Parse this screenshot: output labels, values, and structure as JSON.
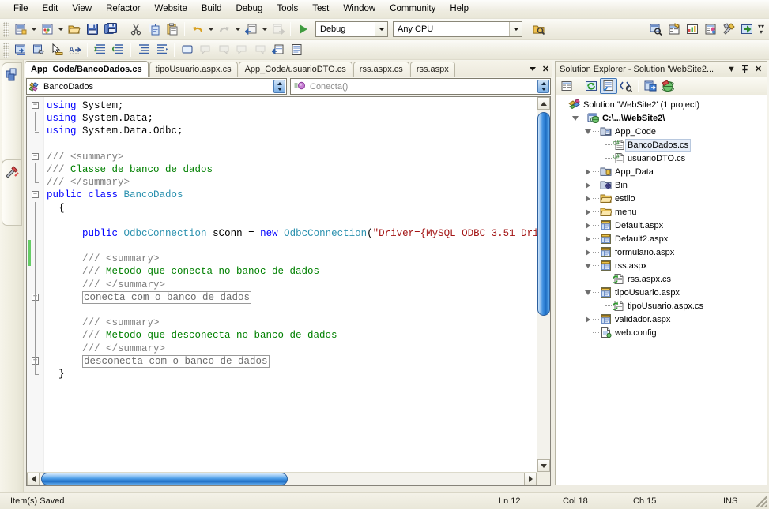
{
  "menu": {
    "items": [
      "File",
      "Edit",
      "View",
      "Refactor",
      "Website",
      "Build",
      "Debug",
      "Tools",
      "Test",
      "Window",
      "Community",
      "Help"
    ]
  },
  "toolbar": {
    "config_value": "Debug",
    "platform_value": "Any CPU",
    "start_tooltip": "Start Debugging",
    "icons_row1": [
      "new-project-icon",
      "new-website-icon",
      "open-file-icon",
      "save-icon",
      "save-all-icon",
      "cut-icon",
      "copy-icon",
      "paste-icon",
      "undo-icon",
      "redo-icon",
      "navigate-backward-icon",
      "navigate-forward-icon"
    ],
    "icons_row2": [
      "solution-explorer-icon",
      "properties-window-icon",
      "object-browser-icon",
      "toolbox-icon",
      "comment-selection-icon",
      "uncomment-selection-icon",
      "increase-indent-icon",
      "decrease-indent-icon",
      "toggle-bookmark-icon",
      "previous-bookmark-icon",
      "next-bookmark-icon",
      "clear-bookmarks-icon",
      "new-item-icon",
      "add-item-icon"
    ],
    "icons_right": [
      "find-in-files-icon",
      "properties-icon",
      "class-view-icon",
      "solution-explorer-icon",
      "tools-options-icon",
      "go-to-icon"
    ]
  },
  "left_rail": {
    "tabs": [
      {
        "name": "toolbox",
        "label": "Toolbox"
      },
      {
        "name": "server-explorer",
        "label": "Server Explorer"
      }
    ]
  },
  "document_tabs": {
    "items": [
      {
        "label": "App_Code/BancoDados.cs",
        "active": true
      },
      {
        "label": "tipoUsuario.aspx.cs",
        "active": false
      },
      {
        "label": "App_Code/usuarioDTO.cs",
        "active": false
      },
      {
        "label": "rss.aspx.cs",
        "active": false
      },
      {
        "label": "rss.aspx",
        "active": false
      }
    ],
    "close_label": "✕"
  },
  "navbar": {
    "type_value": "BancoDados",
    "member_value": "Conecta()"
  },
  "editor": {
    "lines": [
      {
        "outline": "minus",
        "indentbar": false,
        "endtick": false,
        "change": false,
        "tokens": [
          {
            "t": "using",
            "c": "kw"
          },
          {
            "t": " System;",
            "c": "plain"
          }
        ]
      },
      {
        "outline": "none",
        "indentbar": true,
        "endtick": false,
        "change": false,
        "tokens": [
          {
            "t": "using",
            "c": "kw"
          },
          {
            "t": " System.Data;",
            "c": "plain"
          }
        ]
      },
      {
        "outline": "none",
        "indentbar": false,
        "endtick": true,
        "change": false,
        "tokens": [
          {
            "t": "using",
            "c": "kw"
          },
          {
            "t": " System.Data.Odbc;",
            "c": "plain"
          }
        ]
      },
      {
        "outline": "none",
        "indentbar": false,
        "endtick": false,
        "change": false,
        "tokens": []
      },
      {
        "outline": "minus",
        "indentbar": false,
        "endtick": false,
        "change": false,
        "tokens": [
          {
            "t": "/// ",
            "c": "xdoc"
          },
          {
            "t": "<summary>",
            "c": "xdoc"
          }
        ]
      },
      {
        "outline": "none",
        "indentbar": true,
        "endtick": false,
        "change": false,
        "tokens": [
          {
            "t": "/// ",
            "c": "xdoc"
          },
          {
            "t": "Classe de banco de dados",
            "c": "cmt"
          }
        ]
      },
      {
        "outline": "none",
        "indentbar": false,
        "endtick": true,
        "change": false,
        "tokens": [
          {
            "t": "/// ",
            "c": "xdoc"
          },
          {
            "t": "</summary>",
            "c": "xdoc"
          }
        ]
      },
      {
        "outline": "minus",
        "indentbar": false,
        "endtick": false,
        "change": false,
        "tokens": [
          {
            "t": "public class ",
            "c": "kw"
          },
          {
            "t": "BancoDados",
            "c": "typ"
          }
        ]
      },
      {
        "outline": "none",
        "indentbar": true,
        "endtick": false,
        "change": false,
        "tokens": [
          {
            "t": "  {",
            "c": "plain"
          }
        ]
      },
      {
        "outline": "none",
        "indentbar": true,
        "endtick": false,
        "change": false,
        "tokens": []
      },
      {
        "outline": "none",
        "indentbar": true,
        "endtick": false,
        "change": false,
        "tokens": [
          {
            "t": "      public ",
            "c": "kw"
          },
          {
            "t": "OdbcConnection",
            "c": "typ"
          },
          {
            "t": " sConn = ",
            "c": "plain"
          },
          {
            "t": "new ",
            "c": "kw"
          },
          {
            "t": "OdbcConnection",
            "c": "typ"
          },
          {
            "t": "(",
            "c": "plain"
          },
          {
            "t": "\"Driver={MySQL ODBC 3.51 Dri",
            "c": "str"
          }
        ]
      },
      {
        "outline": "none",
        "indentbar": true,
        "endtick": false,
        "change": true,
        "tokens": []
      },
      {
        "outline": "none",
        "indentbar": true,
        "endtick": false,
        "change": true,
        "tokens": [
          {
            "t": "      /// ",
            "c": "xdoc"
          },
          {
            "t": "<summary>",
            "c": "xdoc"
          }
        ],
        "caret": true
      },
      {
        "outline": "none",
        "indentbar": true,
        "endtick": false,
        "change": false,
        "tokens": [
          {
            "t": "      /// ",
            "c": "xdoc"
          },
          {
            "t": "Metodo que conecta no banoc de dados",
            "c": "cmt"
          }
        ]
      },
      {
        "outline": "none",
        "indentbar": true,
        "endtick": false,
        "change": false,
        "tokens": [
          {
            "t": "      /// ",
            "c": "xdoc"
          },
          {
            "t": "</summary>",
            "c": "xdoc"
          }
        ]
      },
      {
        "outline": "plus",
        "indentbar": true,
        "endtick": false,
        "change": false,
        "collapsed": "conecta com o banco de dados",
        "indent": 6,
        "tokens": []
      },
      {
        "outline": "none",
        "indentbar": true,
        "endtick": false,
        "change": false,
        "tokens": []
      },
      {
        "outline": "none",
        "indentbar": true,
        "endtick": false,
        "change": false,
        "tokens": [
          {
            "t": "      /// ",
            "c": "xdoc"
          },
          {
            "t": "<summary>",
            "c": "xdoc"
          }
        ]
      },
      {
        "outline": "none",
        "indentbar": true,
        "endtick": false,
        "change": false,
        "tokens": [
          {
            "t": "      /// ",
            "c": "xdoc"
          },
          {
            "t": "Metodo que desconecta no banco de dados",
            "c": "cmt"
          }
        ]
      },
      {
        "outline": "none",
        "indentbar": true,
        "endtick": false,
        "change": false,
        "tokens": [
          {
            "t": "      /// ",
            "c": "xdoc"
          },
          {
            "t": "</summary>",
            "c": "xdoc"
          }
        ]
      },
      {
        "outline": "plus",
        "indentbar": true,
        "endtick": false,
        "change": false,
        "collapsed": "desconecta com o banco de dados",
        "indent": 6,
        "tokens": []
      },
      {
        "outline": "none",
        "indentbar": false,
        "endtick": true,
        "change": false,
        "tokens": [
          {
            "t": "  }",
            "c": "plain"
          }
        ]
      }
    ],
    "colors": {
      "keyword": "#0000ff",
      "type": "#2b91af",
      "string": "#a31515",
      "comment": "#008000",
      "xmldoc": "#808080",
      "changebar": "#66cc66"
    }
  },
  "solution_explorer": {
    "title": "Solution Explorer - Solution 'WebSite2...",
    "dropdown_glyph": "▼",
    "pin_glyph": "╤",
    "close_glyph": "✕",
    "toolbar_icons": [
      "properties-icon",
      "refresh-icon",
      "nest-related-files-icon",
      "view-code-icon",
      "copy-website-icon",
      "aspnet-configuration-icon"
    ],
    "tree": [
      {
        "label": "Solution 'WebSite2' (1 project)",
        "depth": 0,
        "twisty": "none",
        "icon": "solution-icon",
        "bold": false,
        "selected": false
      },
      {
        "label": "C:\\...\\WebSite2\\",
        "depth": 1,
        "twisty": "down",
        "icon": "website-project-icon",
        "bold": true,
        "selected": false
      },
      {
        "label": "App_Code",
        "depth": 2,
        "twisty": "down",
        "icon": "special-folder-icon",
        "bold": false,
        "selected": false
      },
      {
        "label": "BancoDados.cs",
        "depth": 3,
        "twisty": "none",
        "icon": "csharp-file-icon",
        "bold": false,
        "selected": true
      },
      {
        "label": "usuarioDTO.cs",
        "depth": 3,
        "twisty": "none",
        "icon": "csharp-file-icon",
        "bold": false,
        "selected": false
      },
      {
        "label": "App_Data",
        "depth": 2,
        "twisty": "right",
        "icon": "app-data-folder-icon",
        "bold": false,
        "selected": false
      },
      {
        "label": "Bin",
        "depth": 2,
        "twisty": "right",
        "icon": "bin-folder-icon",
        "bold": false,
        "selected": false
      },
      {
        "label": "estilo",
        "depth": 2,
        "twisty": "right",
        "icon": "folder-icon",
        "bold": false,
        "selected": false
      },
      {
        "label": "menu",
        "depth": 2,
        "twisty": "right",
        "icon": "folder-icon",
        "bold": false,
        "selected": false
      },
      {
        "label": "Default.aspx",
        "depth": 2,
        "twisty": "right",
        "icon": "web-form-icon",
        "bold": false,
        "selected": false
      },
      {
        "label": "Default2.aspx",
        "depth": 2,
        "twisty": "right",
        "icon": "web-form-icon",
        "bold": false,
        "selected": false
      },
      {
        "label": "formulario.aspx",
        "depth": 2,
        "twisty": "right",
        "icon": "web-form-icon",
        "bold": false,
        "selected": false
      },
      {
        "label": "rss.aspx",
        "depth": 2,
        "twisty": "down",
        "icon": "web-form-icon",
        "bold": false,
        "selected": false
      },
      {
        "label": "rss.aspx.cs",
        "depth": 3,
        "twisty": "none",
        "icon": "code-behind-icon",
        "bold": false,
        "selected": false
      },
      {
        "label": "tipoUsuario.aspx",
        "depth": 2,
        "twisty": "down",
        "icon": "web-form-icon",
        "bold": false,
        "selected": false
      },
      {
        "label": "tipoUsuario.aspx.cs",
        "depth": 3,
        "twisty": "none",
        "icon": "code-behind-icon",
        "bold": false,
        "selected": false
      },
      {
        "label": "validador.aspx",
        "depth": 2,
        "twisty": "right",
        "icon": "web-form-icon",
        "bold": false,
        "selected": false
      },
      {
        "label": "web.config",
        "depth": 2,
        "twisty": "none",
        "icon": "config-file-icon",
        "bold": false,
        "selected": false
      }
    ]
  },
  "statusbar": {
    "message": "Item(s) Saved",
    "line": "Ln 12",
    "column": "Col 18",
    "character": "Ch 15",
    "insert_mode": "INS"
  }
}
